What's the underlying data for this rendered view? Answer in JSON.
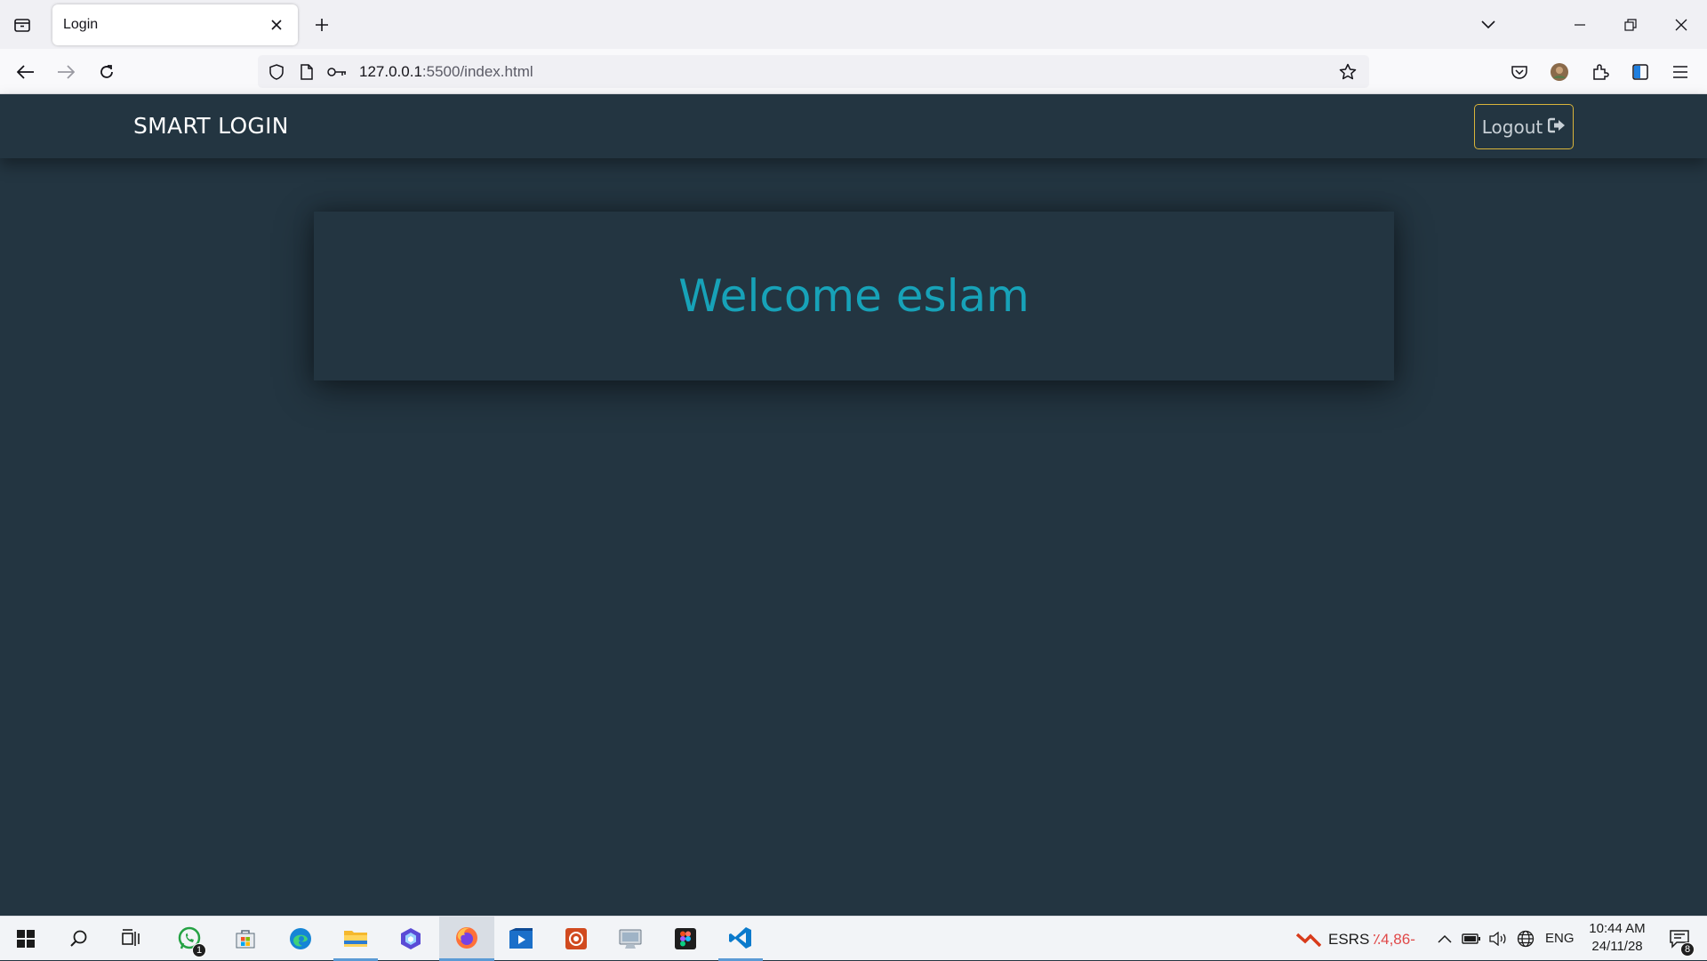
{
  "browser": {
    "tab_title": "Login",
    "url_host": "127.0.0.1",
    "url_rest": ":5500/index.html"
  },
  "site": {
    "brand": "SMART LOGIN",
    "logout_label": "Logout",
    "welcome_text": "Welcome eslam"
  },
  "colors": {
    "page_bg": "#233541",
    "welcome": "#17a2b8",
    "logout_border": "#d9b43a"
  },
  "taskbar": {
    "whatsapp_badge": "1",
    "ticker_name": "ESRS",
    "ticker_value": "٪4,86-",
    "language": "ENG",
    "time": "10:44 AM",
    "date": "24/11/28",
    "notifications_count": "8"
  }
}
